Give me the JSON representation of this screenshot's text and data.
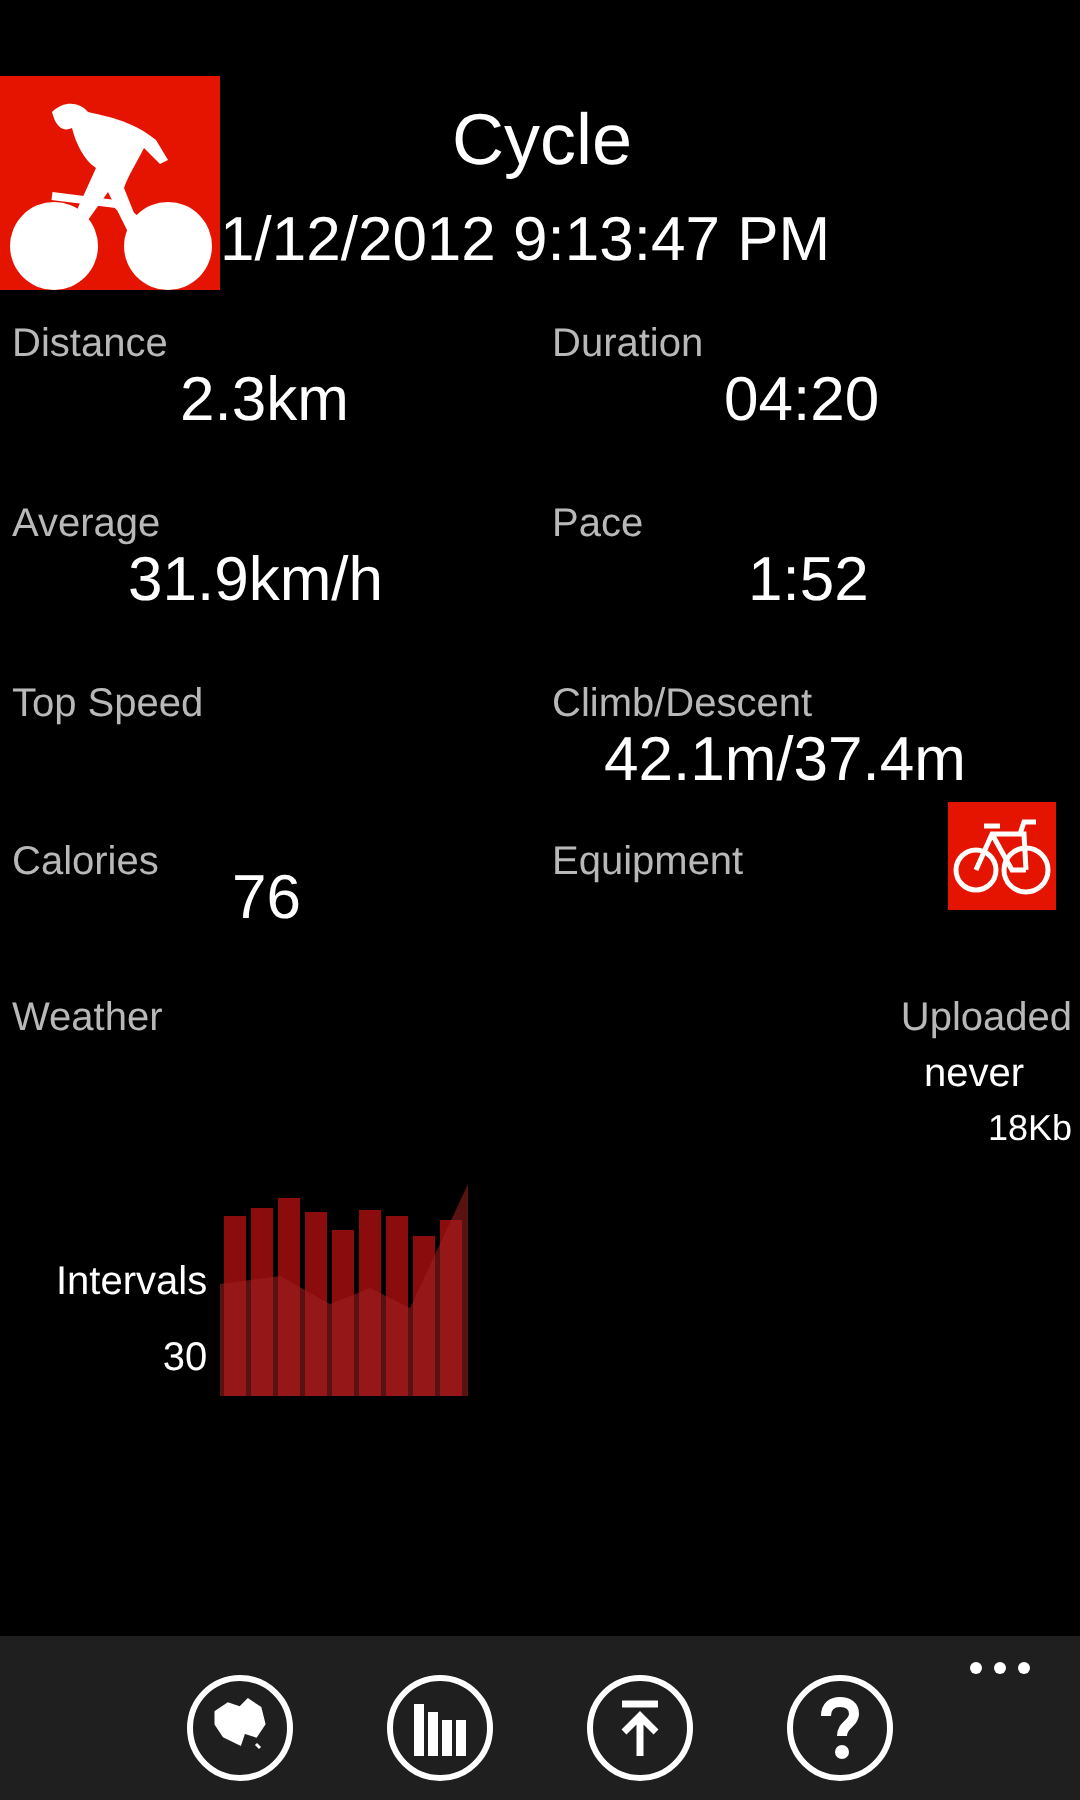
{
  "header": {
    "title": "Cycle",
    "date": "1/12/2012 9:13:47 PM"
  },
  "stats": [
    {
      "left": {
        "label": "Distance",
        "value": "2.3km"
      },
      "right": {
        "label": "Duration",
        "value": "04:20"
      }
    },
    {
      "left": {
        "label": "Average",
        "value": "31.9km/h"
      },
      "right": {
        "label": "Pace",
        "value": "1:52"
      }
    },
    {
      "left": {
        "label": "Top Speed"
      },
      "right": {
        "label": "Climb/Descent",
        "value": "42.1m/37.4m"
      }
    },
    {
      "left": {
        "label": "Calories",
        "value": "76"
      },
      "right": {
        "label": "Equipment",
        "kind": "bike"
      }
    },
    {
      "left": {
        "label": "Weather"
      },
      "right": {
        "label": "Uploaded",
        "value": "never",
        "size": "18Kb",
        "kind": "upload"
      }
    }
  ],
  "intervals": {
    "label": "Intervals",
    "count": "30"
  },
  "app_bar": [
    {
      "kind": "map"
    },
    {
      "kind": "chart"
    },
    {
      "kind": "upload"
    },
    {
      "kind": "help"
    }
  ]
}
